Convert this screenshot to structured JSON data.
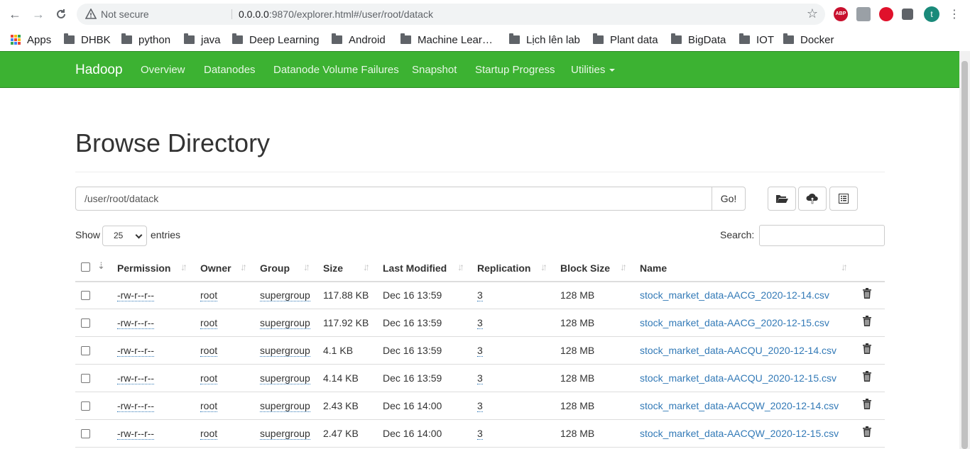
{
  "browser": {
    "not_secure": "Not secure",
    "url_host": "0.0.0.0",
    "url_rest": ":9870/explorer.html#/user/root/datack",
    "profile_initial": "t",
    "abp": "ABP"
  },
  "bookmarks": [
    {
      "label": "Apps",
      "icon": "apps-grid-icon"
    },
    {
      "label": "DHBK",
      "icon": "folder-icon"
    },
    {
      "label": "python",
      "icon": "folder-icon"
    },
    {
      "label": "java",
      "icon": "folder-icon"
    },
    {
      "label": "Deep Learning",
      "icon": "folder-icon"
    },
    {
      "label": "Android",
      "icon": "folder-icon"
    },
    {
      "label": "Machine Lear…",
      "icon": "folder-icon"
    },
    {
      "label": "Lịch lên lab",
      "icon": "folder-icon"
    },
    {
      "label": "Plant data",
      "icon": "folder-icon"
    },
    {
      "label": "BigData",
      "icon": "folder-icon"
    },
    {
      "label": "IOT",
      "icon": "folder-icon"
    },
    {
      "label": "Docker",
      "icon": "folder-icon"
    }
  ],
  "navbar": {
    "brand": "Hadoop",
    "links": [
      "Overview",
      "Datanodes",
      "Datanode Volume Failures",
      "Snapshot",
      "Startup Progress",
      "Utilities"
    ],
    "color": "#3cb232"
  },
  "page": {
    "title": "Browse Directory",
    "path_value": "/user/root/datack",
    "go_label": "Go!",
    "show_label": "Show",
    "entries_value": "25",
    "entries_label": "entries",
    "search_label": "Search:",
    "search_value": ""
  },
  "table": {
    "headers": [
      "Permission",
      "Owner",
      "Group",
      "Size",
      "Last Modified",
      "Replication",
      "Block Size",
      "Name"
    ],
    "rows": [
      {
        "permission": "-rw-r--r--",
        "owner": "root",
        "group": "supergroup",
        "size": "117.88 KB",
        "modified": "Dec 16 13:59",
        "replication": "3",
        "block_size": "128 MB",
        "name": "stock_market_data-AACG_2020-12-14.csv"
      },
      {
        "permission": "-rw-r--r--",
        "owner": "root",
        "group": "supergroup",
        "size": "117.92 KB",
        "modified": "Dec 16 13:59",
        "replication": "3",
        "block_size": "128 MB",
        "name": "stock_market_data-AACG_2020-12-15.csv"
      },
      {
        "permission": "-rw-r--r--",
        "owner": "root",
        "group": "supergroup",
        "size": "4.1 KB",
        "modified": "Dec 16 13:59",
        "replication": "3",
        "block_size": "128 MB",
        "name": "stock_market_data-AACQU_2020-12-14.csv"
      },
      {
        "permission": "-rw-r--r--",
        "owner": "root",
        "group": "supergroup",
        "size": "4.14 KB",
        "modified": "Dec 16 13:59",
        "replication": "3",
        "block_size": "128 MB",
        "name": "stock_market_data-AACQU_2020-12-15.csv"
      },
      {
        "permission": "-rw-r--r--",
        "owner": "root",
        "group": "supergroup",
        "size": "2.43 KB",
        "modified": "Dec 16 14:00",
        "replication": "3",
        "block_size": "128 MB",
        "name": "stock_market_data-AACQW_2020-12-14.csv"
      },
      {
        "permission": "-rw-r--r--",
        "owner": "root",
        "group": "supergroup",
        "size": "2.47 KB",
        "modified": "Dec 16 14:00",
        "replication": "3",
        "block_size": "128 MB",
        "name": "stock_market_data-AACQW_2020-12-15.csv"
      }
    ]
  }
}
